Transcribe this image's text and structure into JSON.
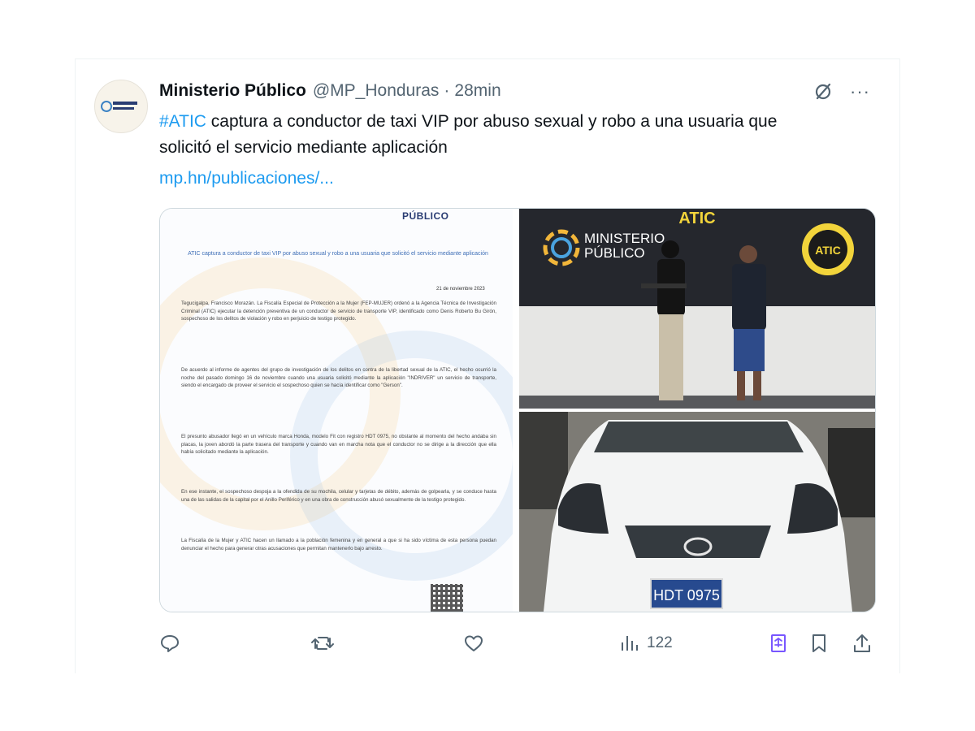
{
  "tweet": {
    "display_name": "Ministerio Público",
    "handle": "@MP_Honduras",
    "separator": "·",
    "time": "28min",
    "hashtag": "#ATIC",
    "text": " captura a conductor de taxi VIP por abuso sexual y robo a una usuaria que solicitó el servicio mediante aplicación",
    "link": "mp.hn/publicaciones/...",
    "avatar_text": "MINISTERIO PÚBLICO",
    "more_label": "···"
  },
  "media": {
    "document": {
      "logo": "PÚBLICO",
      "title": "ATIC captura a conductor de taxi VIP por abuso sexual y robo a una usuaria que solicitó el servicio mediante aplicación",
      "date": "21 de noviembre 2023",
      "paragraphs": [
        "Tegucigalpa, Francisco Morazán. La Fiscalía Especial de Protección a la Mujer (FEP-MUJER) ordenó a la Agencia Técnica de Investigación Criminal (ATIC) ejecutar la detención preventiva de un conductor de servicio de transporte VIP, identificado como Denis Roberto Bu Girón, sospechoso de los delitos de violación y robo en perjuicio de testigo protegido.",
        "De acuerdo al informe de agentes del grupo de investigación de los delitos en contra de la libertad sexual de la ATIC, el hecho ocurrió la noche del pasado domingo 16 de noviembre cuando una usuaria solicitó mediante la aplicación \"INDRIVER\" un servicio de transporte, siendo el encargado de proveer el servicio el sospechoso quien se hacía identificar como \"Gerson\".",
        "El presunto abusador llegó en un vehículo marca Honda, modelo Fit con registro HDT 0975, no obstante al momento del hecho andaba sin placas, la joven abordó la parte trasera del transporte y cuando van en marcha nota que el conductor no se dirige a la dirección que ella había solicitado mediante la aplicación.",
        "En ese instante, el sospechoso despoja a la ofendida de su mochila, celular y tarjetas de débito, además de golpearla, y se conduce hasta una de las salidas de la capital por el Anillo Periférico y en una obra de construcción abusó sexualmente de la testigo protegido.",
        "La Fiscalía de la Mujer y ATIC hacen un llamado a la población femenina y en general a que si ha sido víctima de esta persona puedan denunciar el hecho para generar otras acusaciones que permitan mantenerlo bajo arresto."
      ]
    },
    "photo_top": {
      "banner": "ATIC",
      "org_line1": "MINISTERIO",
      "org_line2": "PÚBLICO",
      "badge": "ATIC"
    },
    "photo_bottom": {
      "plate": "HDT 0975"
    }
  },
  "actions": {
    "views": "122"
  },
  "colors": {
    "link": "#1d9bf0",
    "text": "#0f1419",
    "muted": "#536471",
    "bookmark_accent": "#7856ff"
  }
}
